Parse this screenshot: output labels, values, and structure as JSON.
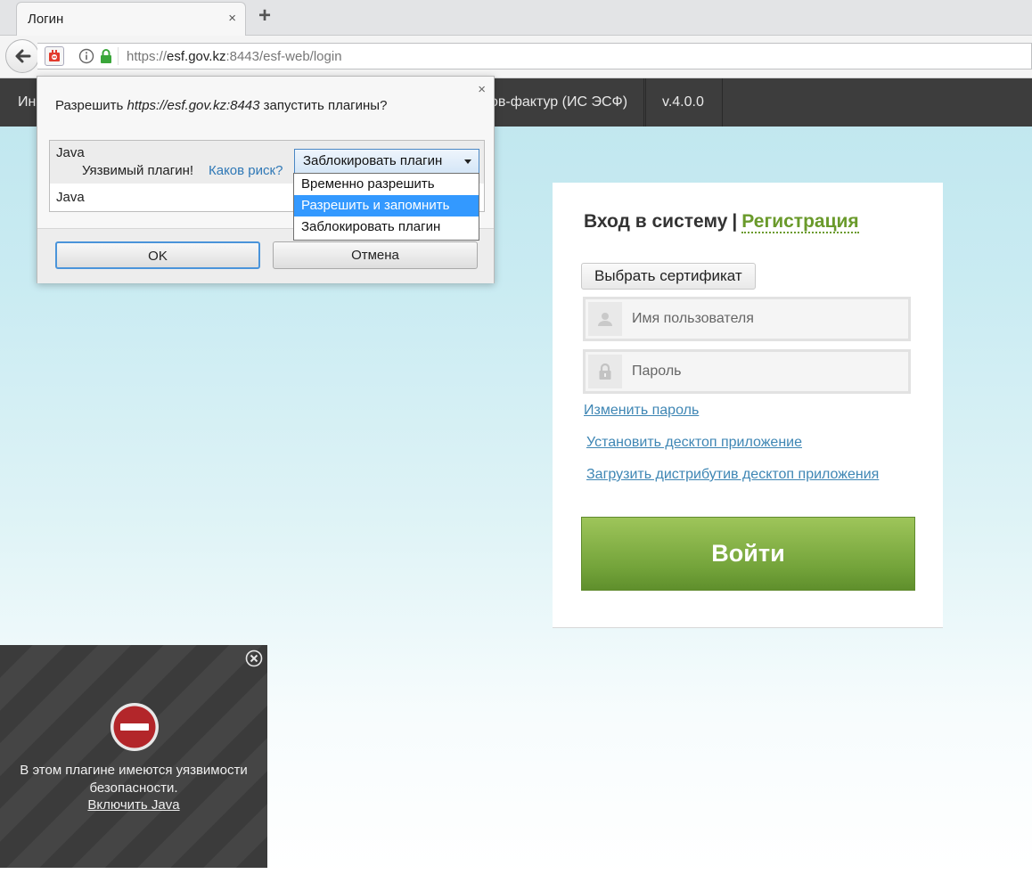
{
  "browser": {
    "tab_title": "Логин",
    "tab_close": "×",
    "new_tab": "+",
    "url_prefix": "https://",
    "url_host": "esf.gov.kz",
    "url_rest": ":8443/esf-web/login"
  },
  "header": {
    "item_left": "Ин",
    "item_title": "ов-фактур (ИС ЭСФ)",
    "version": "v.4.0.0"
  },
  "login": {
    "title": "Вход в систему",
    "separator": "|",
    "register": "Регистрация",
    "cert_button": "Выбрать сертификат",
    "username_placeholder": "Имя пользователя",
    "password_placeholder": "Пароль",
    "change_password": "Изменить пароль",
    "install_desktop": "Установить десктоп приложение",
    "download_desktop": "Загрузить дистрибутив десктоп приложения",
    "submit": "Войти"
  },
  "popup": {
    "close": "×",
    "question_pre": "Разрешить ",
    "question_site": "https://esf.gov.kz:8443",
    "question_post": " запустить плагины?",
    "plugin1_name": "Java",
    "plugin1_warning": "Уязвимый плагин!",
    "plugin1_risk": "Каков риск?",
    "plugin1_selected": "Заблокировать плагин",
    "plugin2_name": "Java",
    "options": [
      "Временно разрешить",
      "Разрешить и запомнить",
      "Заблокировать плагин"
    ],
    "highlighted_option_index": 1,
    "ok": "OK",
    "cancel": "Отмена"
  },
  "blocked": {
    "message_line1": "В этом плагине имеются уязвимости",
    "message_line2": "безопасности.",
    "enable": "Включить Java"
  },
  "colors": {
    "header_bg": "#3d3d3d",
    "accent_green": "#73a33a",
    "link_blue": "#3e86b4",
    "dropdown_highlight": "#3399ff"
  }
}
